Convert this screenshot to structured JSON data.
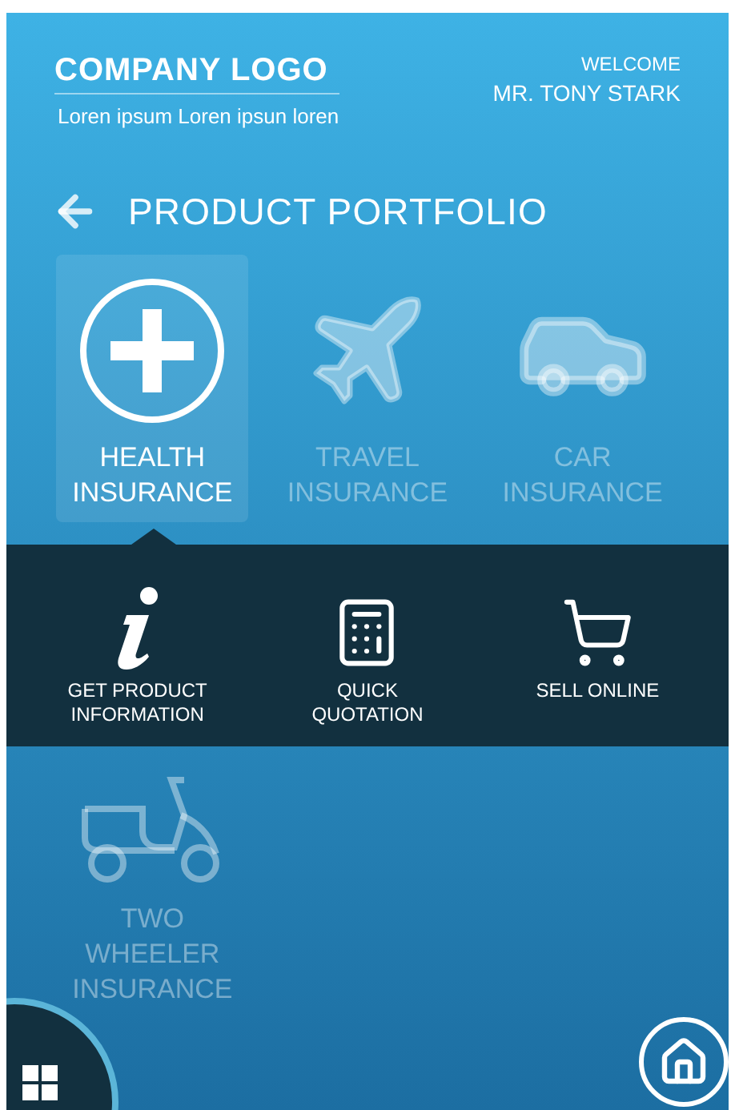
{
  "header": {
    "logo": "COMPANY LOGO",
    "tagline": "Loren ipsum Loren ipsun loren",
    "welcome": "WELCOME",
    "user_name": "MR. TONY STARK"
  },
  "page_title": "PRODUCT PORTFOLIO",
  "products": [
    {
      "kind": "health",
      "label": "HEALTH INSURANCE",
      "selected": true
    },
    {
      "kind": "travel",
      "label": "TRAVEL INSURANCE",
      "selected": false
    },
    {
      "kind": "car",
      "label": "CAR INSURANCE",
      "selected": false
    },
    {
      "kind": "two_wheeler",
      "label": "TWO WHEELER INSURANCE",
      "selected": false
    }
  ],
  "actions": [
    {
      "kind": "info",
      "label": "GET PRODUCT INFORMATION"
    },
    {
      "kind": "calculator",
      "label": "QUICK QUOTATION"
    },
    {
      "kind": "cart",
      "label": "SELL ONLINE"
    }
  ]
}
